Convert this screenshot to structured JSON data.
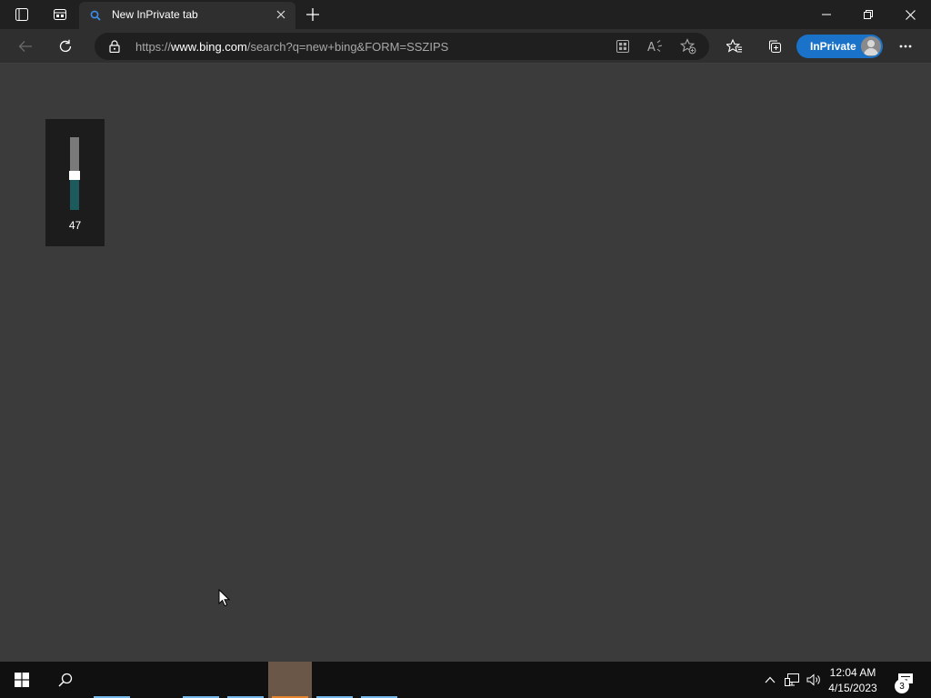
{
  "browser": {
    "tab": {
      "title": "New InPrivate tab",
      "icon": "search-icon"
    },
    "address": {
      "prefix": "https://",
      "host": "www.bing.com",
      "path": "/search?q=new+bing&FORM=SSZIPS"
    },
    "inprivate_label": "InPrivate",
    "accent_color": "#1a73c8"
  },
  "volume_flyout": {
    "value": "47",
    "level_percent": 47
  },
  "taskbar": {
    "time": "12:04 AM",
    "date": "4/15/2023",
    "notification_count": "3",
    "apps": [
      {
        "name": "app-1",
        "active": false
      },
      {
        "name": "app-2",
        "active": false
      },
      {
        "name": "app-3",
        "active": false
      },
      {
        "name": "app-4",
        "active": true
      },
      {
        "name": "app-5",
        "active": false
      },
      {
        "name": "app-6",
        "active": false
      }
    ]
  }
}
